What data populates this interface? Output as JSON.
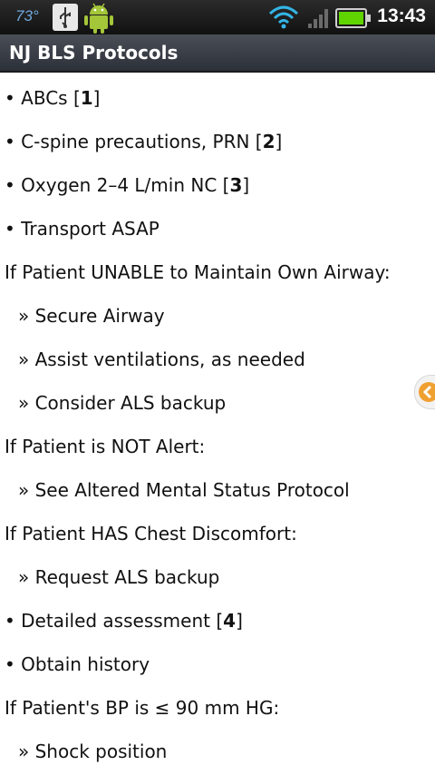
{
  "status_bar": {
    "temperature": "73°",
    "time": "13:43",
    "icons": [
      "usb-icon",
      "android-icon",
      "wifi-icon",
      "signal-icon",
      "battery-icon"
    ]
  },
  "app": {
    "title": "NJ BLS Protocols"
  },
  "content": {
    "lines": [
      {
        "kind": "bullet",
        "text": "• ABCs [",
        "ref": "1",
        "suffix": "]"
      },
      {
        "kind": "bullet",
        "text": "• C-spine precautions, PRN [",
        "ref": "2",
        "suffix": "]"
      },
      {
        "kind": "bullet",
        "text": "• Oxygen 2–4 L/min NC [",
        "ref": "3",
        "suffix": "]"
      },
      {
        "kind": "bullet",
        "text": "• Transport ASAP"
      },
      {
        "kind": "head",
        "text": "If Patient UNABLE to Maintain Own Airway:"
      },
      {
        "kind": "sub",
        "text": "» Secure Airway"
      },
      {
        "kind": "sub",
        "text": "» Assist ventilations, as needed"
      },
      {
        "kind": "sub",
        "text": "» Consider ALS backup"
      },
      {
        "kind": "head",
        "text": "If Patient is NOT Alert:"
      },
      {
        "kind": "sub",
        "text": "» See Altered Mental Status Protocol"
      },
      {
        "kind": "head",
        "text": "If Patient HAS Chest Discomfort:"
      },
      {
        "kind": "sub",
        "text": "» Request ALS backup"
      },
      {
        "kind": "bullet",
        "text": "• Detailed assessment [",
        "ref": "4",
        "suffix": "]"
      },
      {
        "kind": "bullet",
        "text": "• Obtain history"
      },
      {
        "kind": "head",
        "text": "If Patient's BP is ≤ 90 mm HG:"
      },
      {
        "kind": "sub",
        "text": "» Shock position"
      }
    ]
  },
  "colors": {
    "status_bg": "#111111",
    "title_bg": "#3a3f47",
    "text": "#111111",
    "battery": "#5fd400",
    "wifi": "#33b5e5",
    "side_tab_arrow": "#f0a030"
  }
}
